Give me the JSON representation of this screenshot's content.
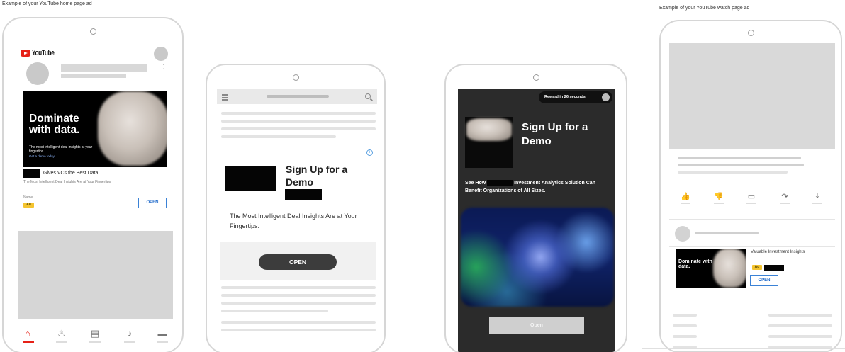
{
  "captions": {
    "home": "Example of your YouTube home page ad",
    "watch": "Example of your YouTube watch page ad"
  },
  "home_ad": {
    "logo_text": "YouTube",
    "hero_title": "Dominate with data.",
    "hero_subtitle": "The most intelligent deal insights at your fingertips.",
    "hero_link": "Get a demo today",
    "headline": "Gives VCs the Best Data",
    "description": "The Most Intelligent Deal Insights Are at Your Fingertips",
    "advertiser": "Name",
    "ad_badge": "Ad",
    "open_label": "OPEN",
    "nav_icons": [
      "home-icon",
      "trending-icon",
      "subscriptions-icon",
      "notifications-icon",
      "library-icon"
    ]
  },
  "web_ad": {
    "headline": "Sign Up for a Demo",
    "description": "The Most Intelligent Deal Insights Are at Your Fingertips.",
    "open_label": "OPEN",
    "adchoice_glyph": "i"
  },
  "reward_ad": {
    "reward_text": "Reward in 26 seconds",
    "headline": "Sign Up for a Demo",
    "description_before": "See How",
    "description_after": "Investment Analytics Solution Can Benefit Organizations of All Sizes.",
    "open_label": "Open"
  },
  "watch_ad": {
    "hero_title": "Dominate with data.",
    "title": "Valuable Investment Insights",
    "ad_badge": "Ad",
    "open_label": "OPEN",
    "actions": [
      "like-icon",
      "dislike-icon",
      "comment-icon",
      "share-icon",
      "download-icon"
    ]
  },
  "colors": {
    "youtube_red": "#e62117",
    "ad_yellow": "#f4c430",
    "link_blue": "#1a66c9",
    "dark_screen": "#2b2b2b"
  }
}
